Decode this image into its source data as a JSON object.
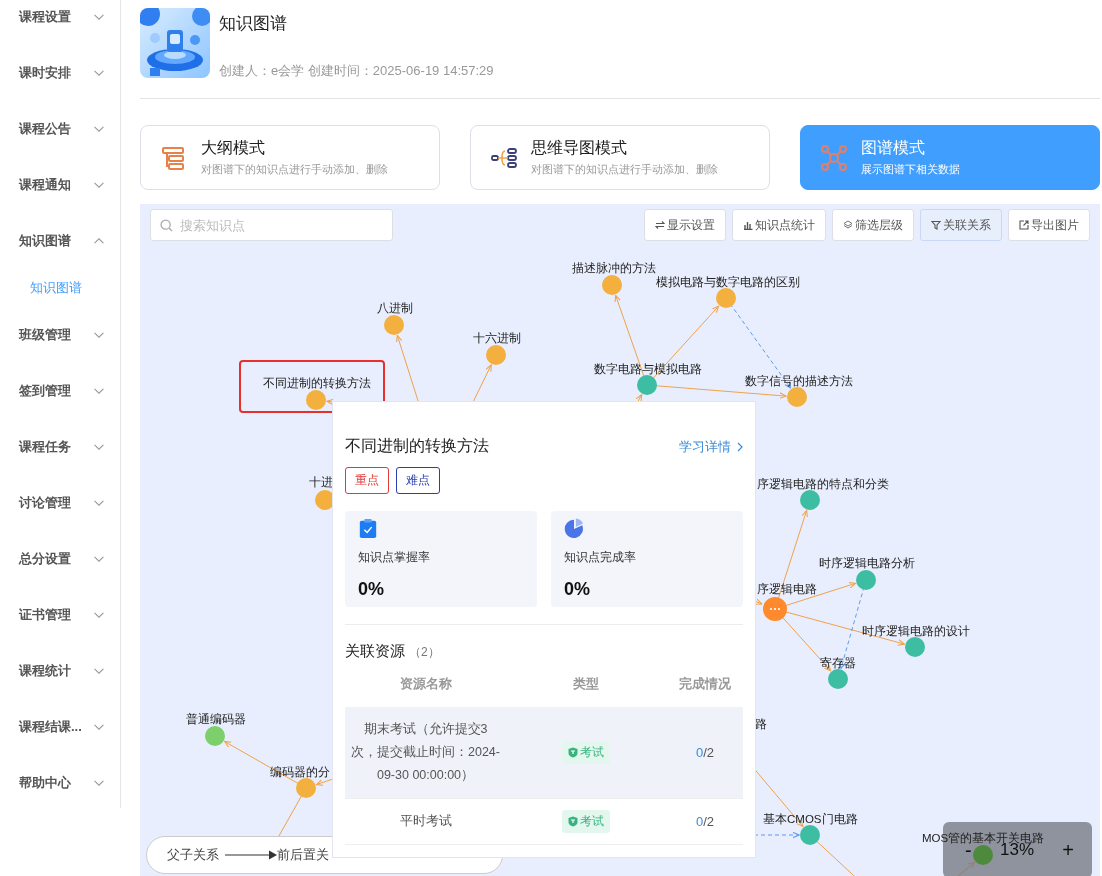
{
  "sidebar": {
    "items": [
      {
        "label": "课程设置",
        "expanded": false
      },
      {
        "label": "课时安排",
        "expanded": false
      },
      {
        "label": "课程公告",
        "expanded": false
      },
      {
        "label": "课程通知",
        "expanded": false
      },
      {
        "label": "知识图谱",
        "expanded": true,
        "children": [
          {
            "label": "知识图谱",
            "selected": true
          }
        ]
      },
      {
        "label": "班级管理",
        "expanded": false
      },
      {
        "label": "签到管理",
        "expanded": false
      },
      {
        "label": "课程任务",
        "expanded": false
      },
      {
        "label": "讨论管理",
        "expanded": false
      },
      {
        "label": "总分设置",
        "expanded": false
      },
      {
        "label": "证书管理",
        "expanded": false
      },
      {
        "label": "课程统计",
        "expanded": false
      },
      {
        "label": "课程结课...",
        "expanded": false
      },
      {
        "label": "帮助中心",
        "expanded": false
      }
    ]
  },
  "header": {
    "title": "知识图谱",
    "meta": "创建人：e会学 创建时间：2025-06-19 14:57:29"
  },
  "modes": [
    {
      "kind": "outline",
      "title": "大纲模式",
      "subtitle": "对图谱下的知识点进行手动添加、删除",
      "selected": false
    },
    {
      "kind": "mindmap",
      "title": "思维导图模式",
      "subtitle": "对图谱下的知识点进行手动添加、删除",
      "selected": false
    },
    {
      "kind": "graph",
      "title": "图谱模式",
      "subtitle": "展示图谱下相关数据",
      "selected": true
    }
  ],
  "canvas": {
    "search": {
      "placeholder": "搜索知识点"
    },
    "toolbar": [
      {
        "kind": "display",
        "label": "显示设置",
        "selected": false
      },
      {
        "kind": "stats",
        "label": "知识点统计",
        "selected": false
      },
      {
        "kind": "layers",
        "label": "筛选层级",
        "selected": false
      },
      {
        "kind": "filter",
        "label": "关联关系",
        "selected": true
      },
      {
        "kind": "export",
        "label": "导出图片",
        "selected": false
      }
    ],
    "nodes": [
      {
        "label": "描述脉冲的方法",
        "color": "#f3b03e"
      },
      {
        "label": "模拟电路与数字电路的区别",
        "color": "#f3b03e"
      },
      {
        "label": "八进制",
        "color": "#f3b03e"
      },
      {
        "label": "十六进制",
        "color": "#f3b03e"
      },
      {
        "label": "不同进制的转换方法",
        "color": "#f3b03e",
        "highlighted": true
      },
      {
        "label": "数字电路与模拟电路",
        "color": "#3dbea2"
      },
      {
        "label": "数字信号的描述方法",
        "color": "#f3b03e"
      },
      {
        "label": "十进",
        "color": "#f3b03e"
      },
      {
        "label": "序逻辑电路的特点和分类",
        "color": "#3dbea2"
      },
      {
        "label": "时序逻辑电路分析",
        "color": "#3dbea2"
      },
      {
        "label": "序逻辑电路",
        "color": "#ff8a2e",
        "focused": true
      },
      {
        "label": "时序逻辑电路的设计",
        "color": "#3dbea2"
      },
      {
        "label": "寄存器",
        "color": "#3dbea2"
      },
      {
        "label": "路"
      },
      {
        "label": "普通编码器",
        "color": "#7dcf6b"
      },
      {
        "label": "编码器的分",
        "color": "#f3b03e"
      },
      {
        "label": "基本CMOS门电路",
        "color": "#3dbea2"
      },
      {
        "label": "MOS管的基本开关电路",
        "color": "#4e8a3e"
      }
    ],
    "edges": [
      {
        "kind": "parent"
      },
      {
        "kind": "parent"
      },
      {
        "kind": "parent"
      },
      {
        "kind": "prerequisite"
      },
      {
        "kind": "parent"
      },
      {
        "kind": "parent"
      },
      {
        "kind": "parent"
      },
      {
        "kind": "parent"
      },
      {
        "kind": "parent"
      },
      {
        "kind": "parent"
      },
      {
        "kind": "parent"
      },
      {
        "kind": "parent"
      },
      {
        "kind": "prerequisite"
      },
      {
        "kind": "parent"
      },
      {
        "kind": "parent"
      },
      {
        "kind": "parent"
      },
      {
        "kind": "parent"
      },
      {
        "kind": "parent"
      },
      {
        "kind": "prerequisite"
      },
      {
        "kind": "parent"
      },
      {
        "kind": "parent"
      }
    ],
    "legend": [
      {
        "label": "父子关系",
        "arrow": true
      },
      {
        "label": "前后置关",
        "arrow": false
      }
    ],
    "zoom": {
      "minus": "-",
      "value": "13%",
      "plus": "+"
    }
  },
  "popup": {
    "title": "不同进制的转换方法",
    "link": "学习详情",
    "tags": [
      {
        "kind": "key",
        "label": "重点"
      },
      {
        "kind": "difficult",
        "label": "难点"
      }
    ],
    "stats": [
      {
        "kind": "mastery",
        "label": "知识点掌握率",
        "value": "0%"
      },
      {
        "kind": "completion",
        "label": "知识点完成率",
        "value": "0%"
      }
    ],
    "resources": {
      "title": "关联资源",
      "count": "（2）",
      "columns": [
        "资源名称",
        "类型",
        "完成情况"
      ],
      "rows": [
        {
          "name": "期末考试（允许提交3次，提交截止时间：2024-09-30 00:00:00）",
          "type": "考试",
          "done": "0",
          "rest": "/2",
          "highlighted": true
        },
        {
          "name": "平时考试",
          "type": "考试",
          "done": "0",
          "rest": "/2",
          "highlighted": false
        }
      ]
    }
  }
}
